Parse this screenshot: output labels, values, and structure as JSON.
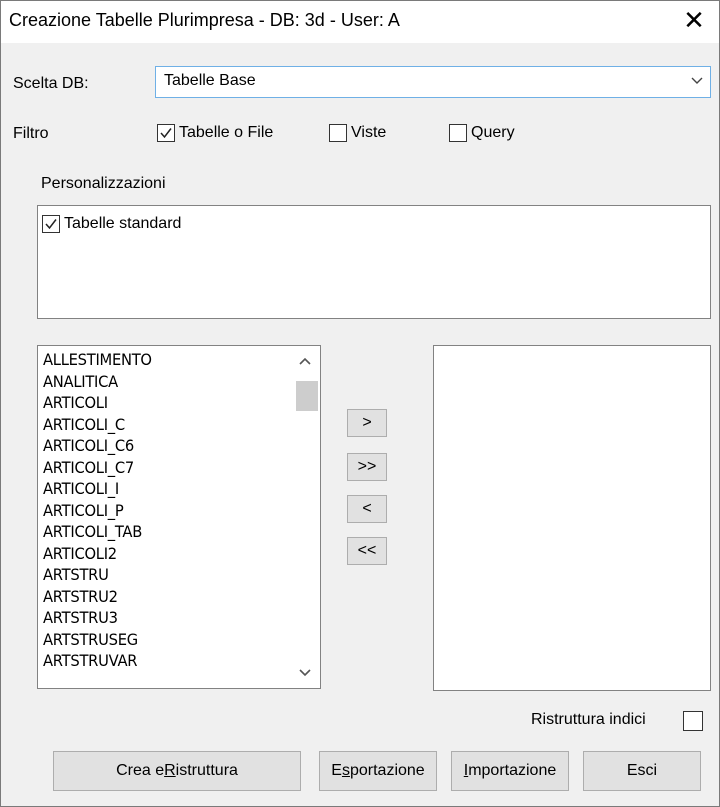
{
  "window": {
    "title": "Creazione Tabelle Plurimpresa - DB: 3d - User: A",
    "close_glyph": "✕"
  },
  "db": {
    "label": "Scelta DB:",
    "selected": "Tabelle Base"
  },
  "filter": {
    "label": "Filtro",
    "options": [
      {
        "label": "Tabelle o File",
        "checked": true
      },
      {
        "label": "Viste",
        "checked": false
      },
      {
        "label": "Query",
        "checked": false
      }
    ]
  },
  "customizations": {
    "label": "Personalizzazioni",
    "items": [
      {
        "label": "Tabelle standard",
        "checked": true
      }
    ]
  },
  "available_tables": [
    "ALLESTIMENTO",
    "ANALITICA",
    "ARTICOLI",
    "ARTICOLI_C",
    "ARTICOLI_C6",
    "ARTICOLI_C7",
    "ARTICOLI_I",
    "ARTICOLI_P",
    "ARTICOLI_TAB",
    "ARTICOLI2",
    "ARTSTRU",
    "ARTSTRU2",
    "ARTSTRU3",
    "ARTSTRUSEG",
    "ARTSTRUVAR"
  ],
  "selected_tables": [],
  "move_buttons": {
    "add": ">",
    "add_all": ">>",
    "remove": "<",
    "remove_all": "<<"
  },
  "rebuild_indexes": {
    "label": "Ristruttura indici",
    "checked": false
  },
  "actions": {
    "create_pre": "Crea e ",
    "create_key": "R",
    "create_post": "istruttura",
    "export_pre": "E",
    "export_key": "s",
    "export_post": "portazione",
    "import_key": "I",
    "import_post": "mportazione",
    "exit": "Esci"
  }
}
